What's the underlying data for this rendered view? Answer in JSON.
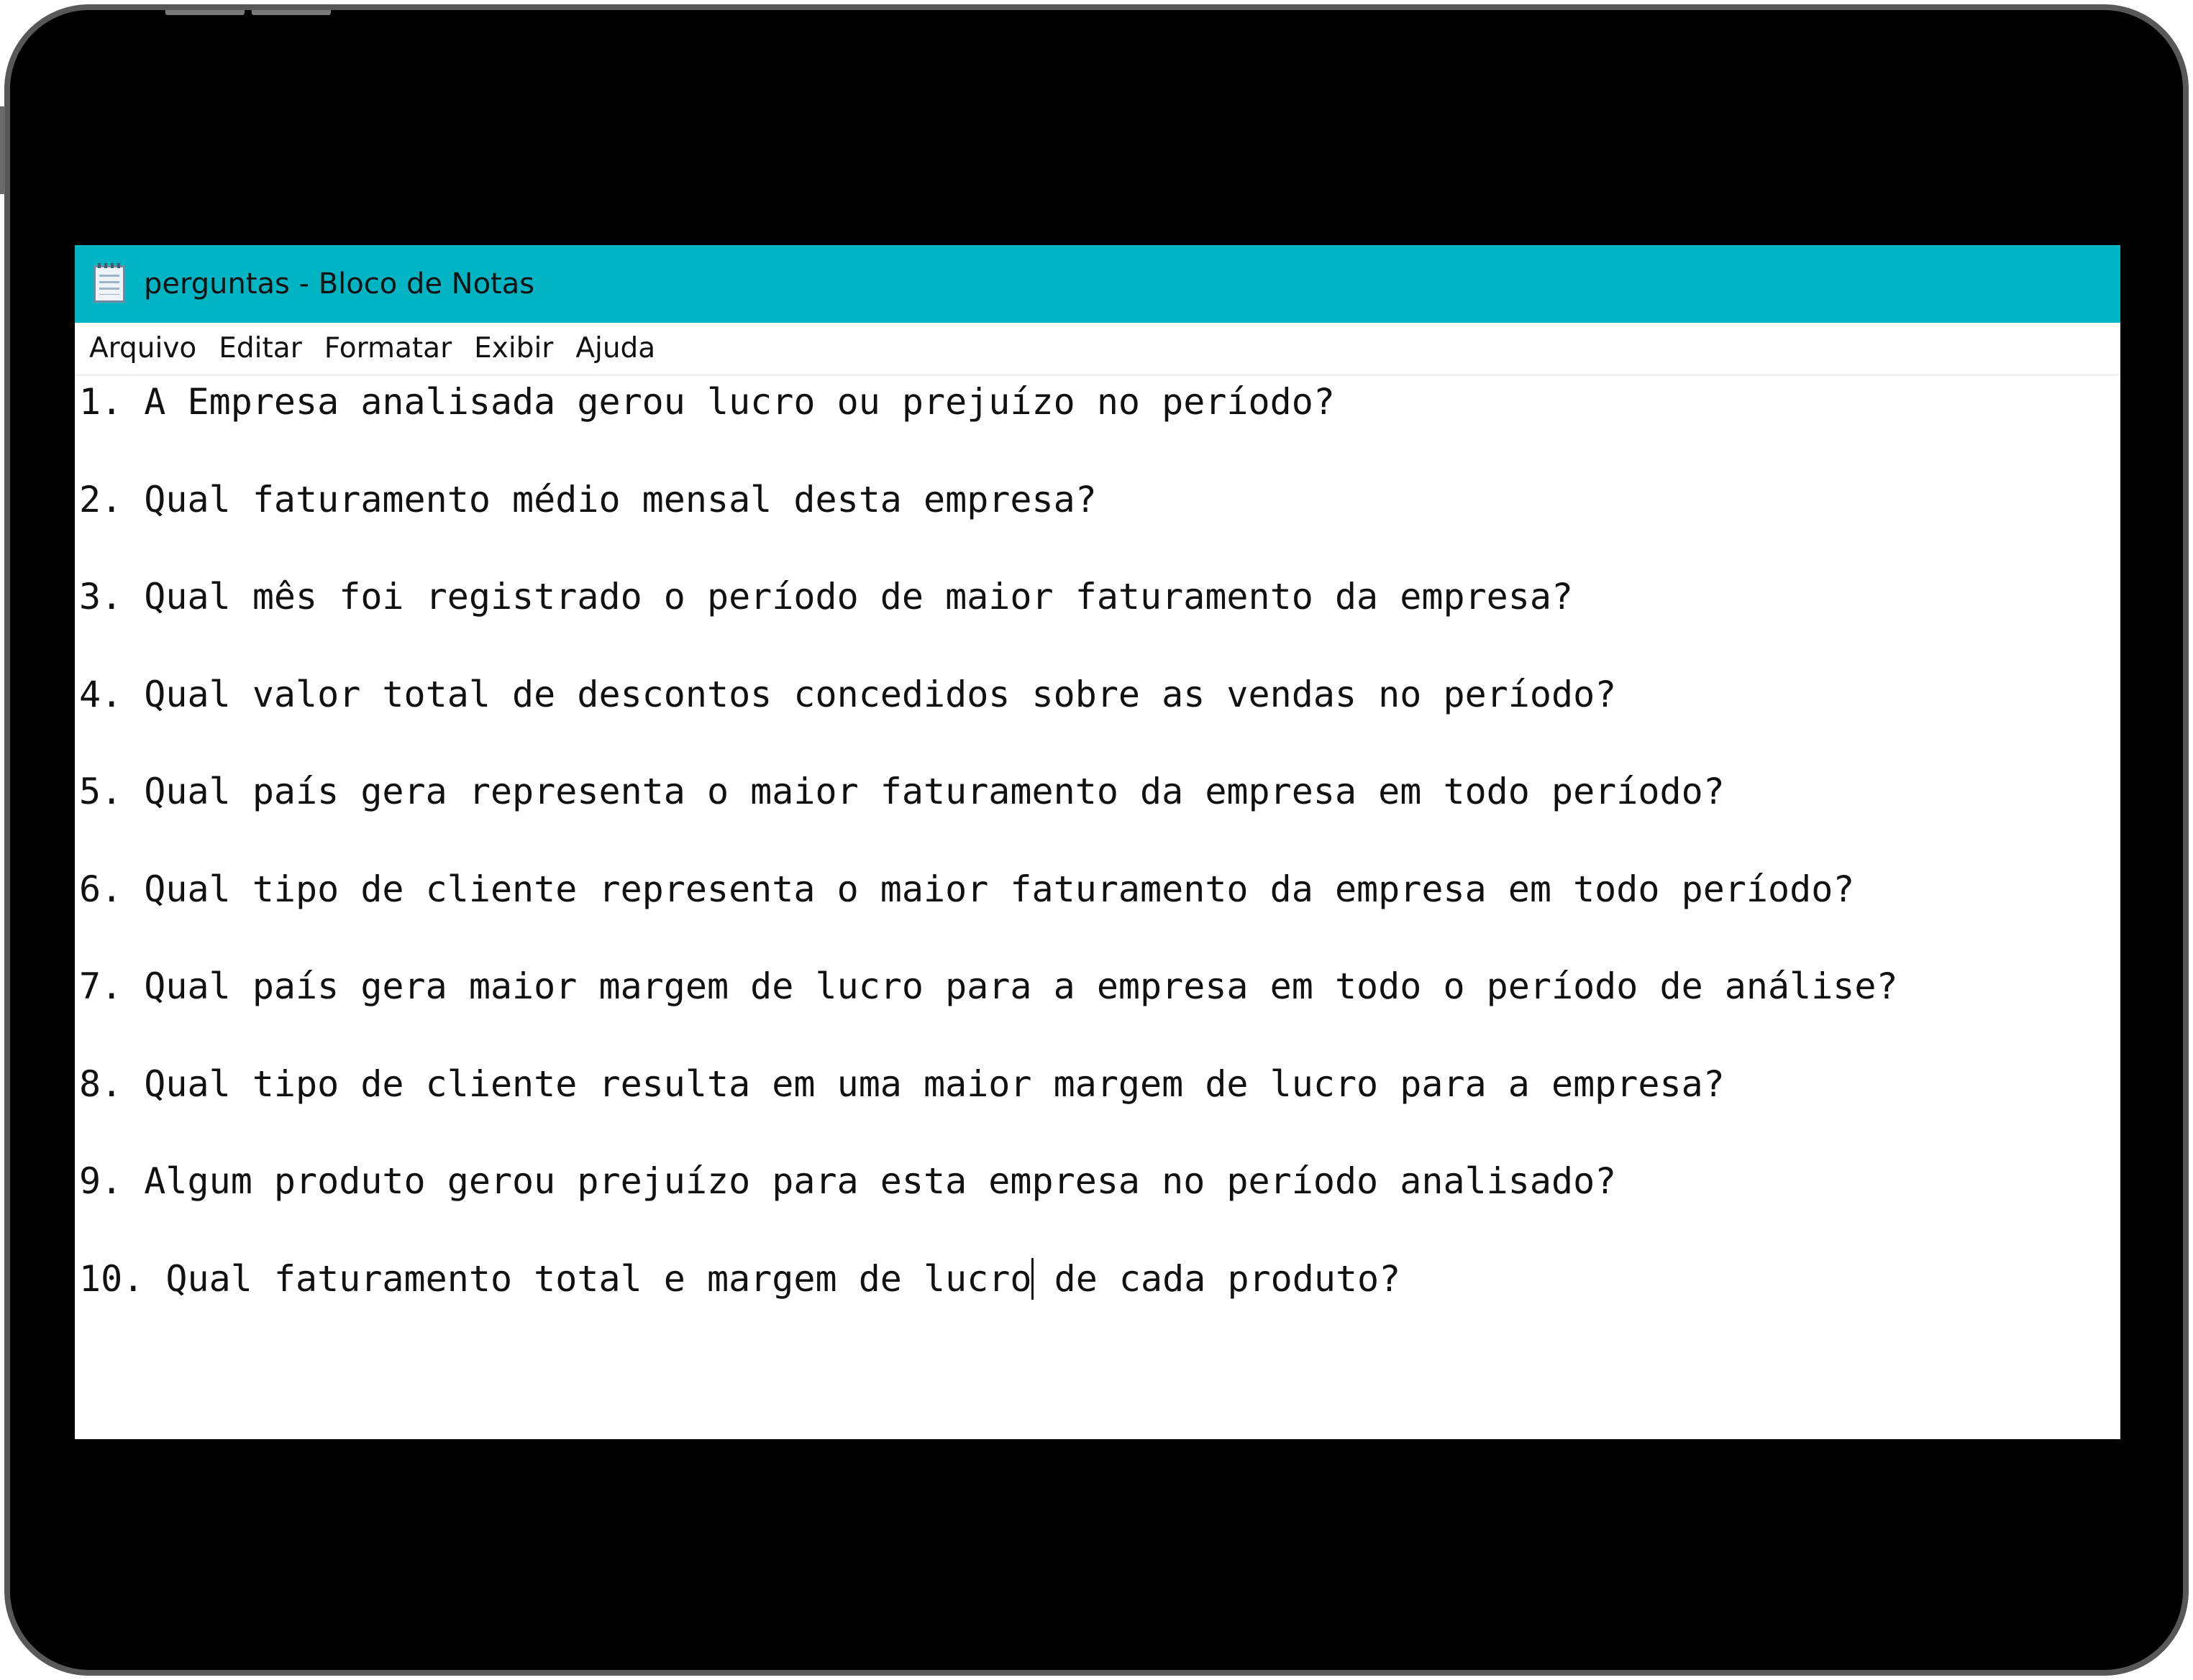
{
  "window": {
    "title": "perguntas - Bloco de Notas"
  },
  "menu": [
    "Arquivo",
    "Editar",
    "Formatar",
    "Exibir",
    "Ajuda"
  ],
  "editor": {
    "lines": [
      "1. A Empresa analisada gerou lucro ou prejuízo no período?",
      "2. Qual faturamento médio mensal desta empresa?",
      "3. Qual mês foi registrado o período de maior faturamento da empresa?",
      "4. Qual valor total de descontos concedidos sobre as vendas no período?",
      "5. Qual país gera representa o maior faturamento da empresa em todo período?",
      "6. Qual tipo de cliente representa o maior faturamento da empresa em todo período?",
      "7. Qual país gera maior margem de lucro para a empresa em todo o período de análise?",
      "8. Qual tipo de cliente resulta em uma maior margem de lucro para a empresa?",
      "9. Algum produto gerou prejuízo para esta empresa no período analisado?"
    ],
    "last_line_before_caret": "10. Qual faturamento total e margem de lucro",
    "last_line_after_caret": " de cada produto?"
  },
  "colors": {
    "titlebar": "#00b4c4",
    "bezel": "#000000"
  },
  "icons": {
    "app": "notepad-icon"
  }
}
